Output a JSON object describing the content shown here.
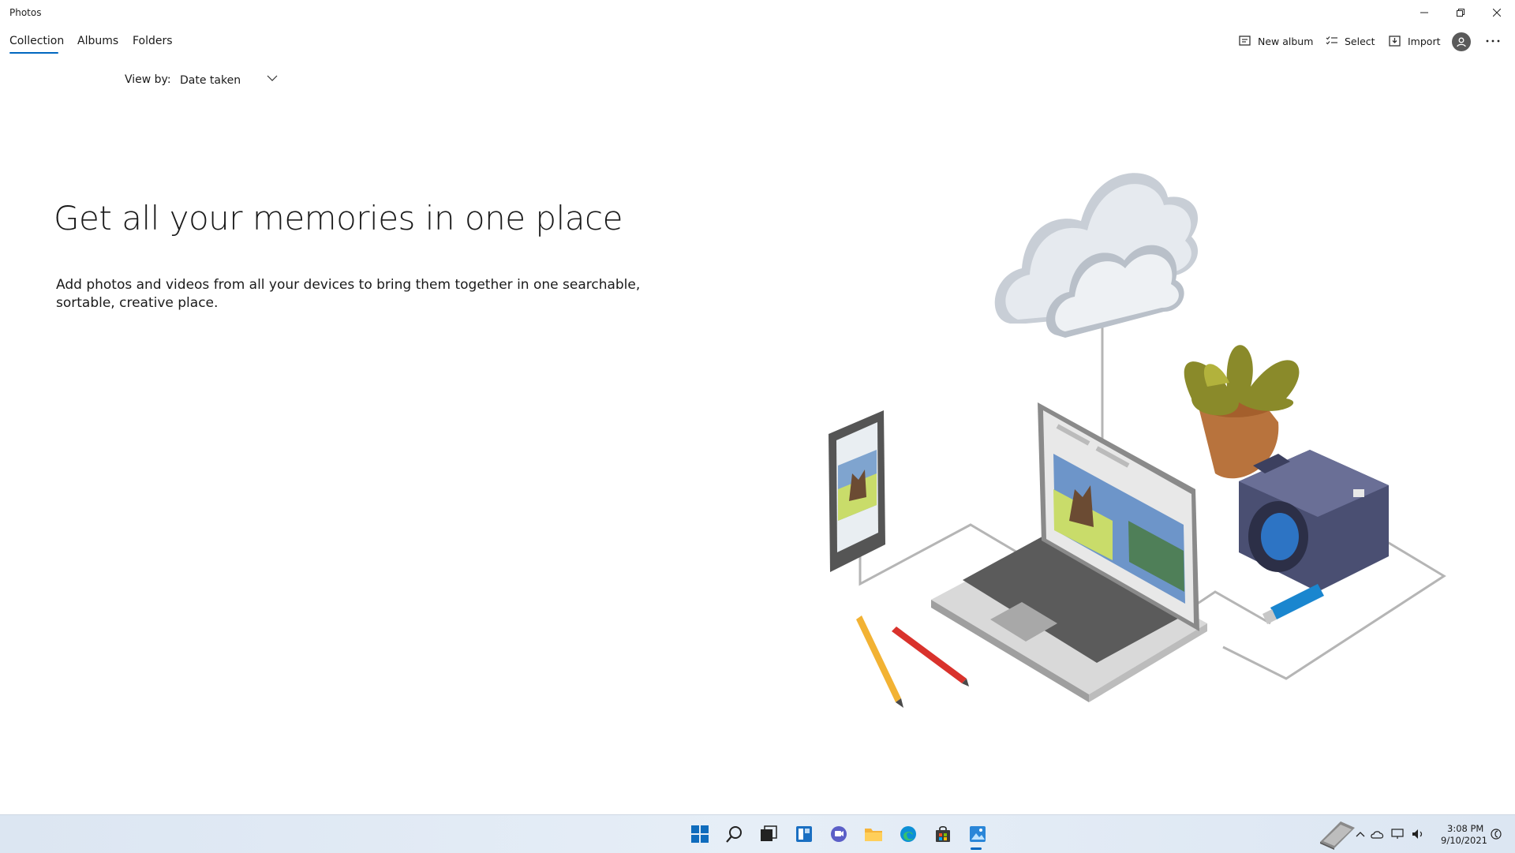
{
  "window": {
    "title": "Photos"
  },
  "tabs": [
    {
      "label": "Collection"
    },
    {
      "label": "Albums"
    },
    {
      "label": "Folders"
    }
  ],
  "toolbar": {
    "new_album": "New album",
    "select": "Select",
    "import": "Import"
  },
  "view_by": {
    "label": "View by:",
    "value": "Date taken"
  },
  "hero": {
    "title": "Get all your memories in one place",
    "description": "Add photos and videos from all your devices to bring them together in one searchable, sortable, creative place."
  },
  "clock": {
    "time": "3:08 PM",
    "date": "9/10/2021"
  },
  "colors": {
    "accent": "#0067c0"
  }
}
